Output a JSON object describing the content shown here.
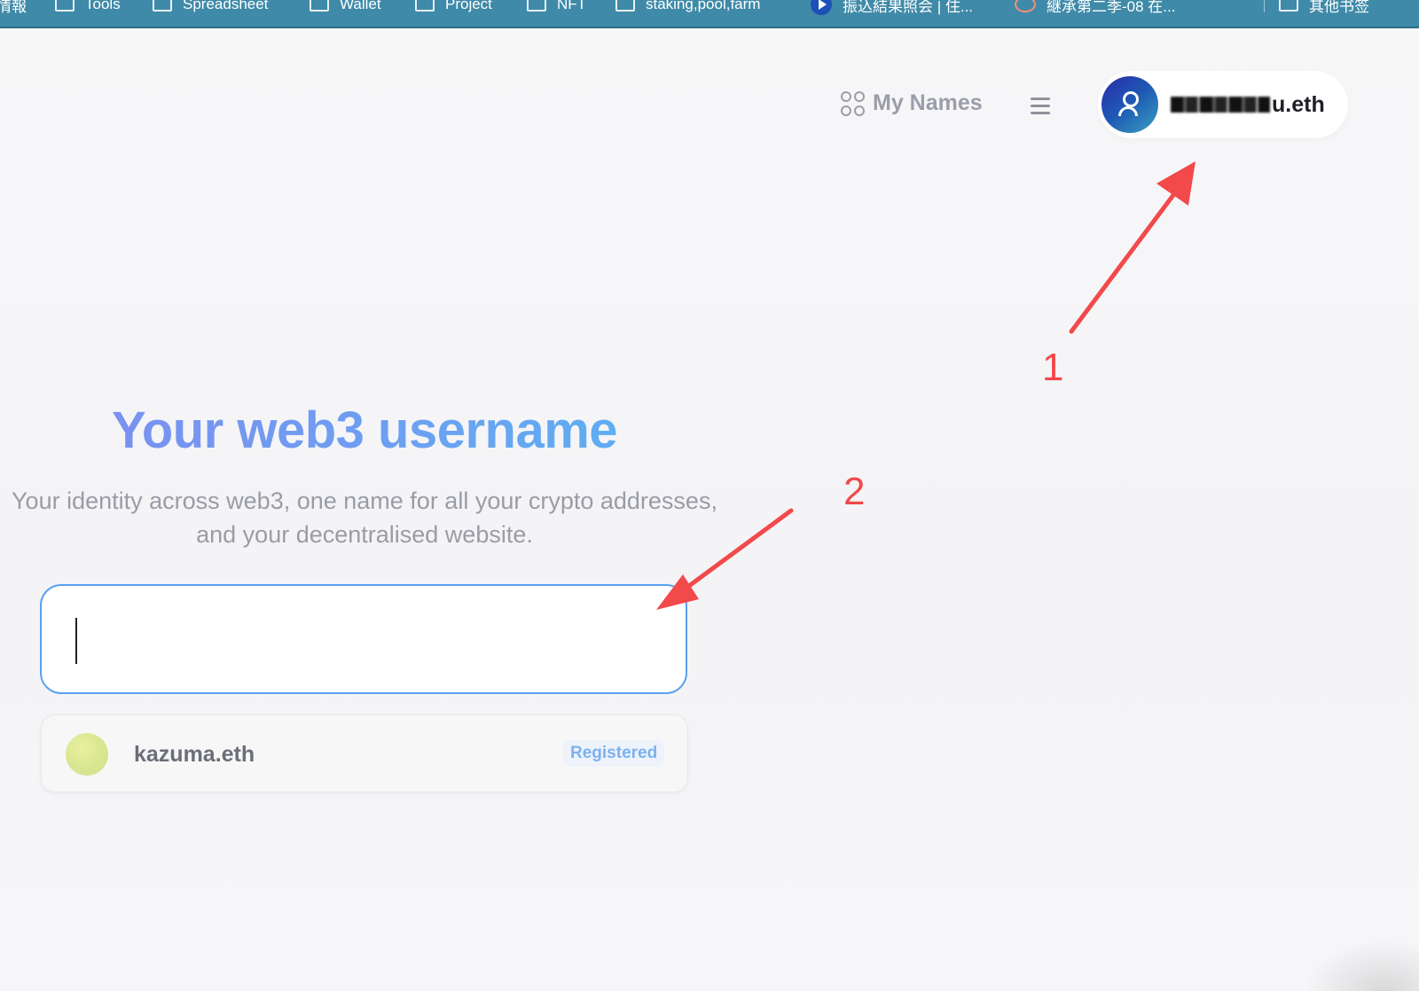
{
  "bookmarks_bar": {
    "items": [
      {
        "label": "情報",
        "icon": "none"
      },
      {
        "label": "Tools",
        "icon": "folder-icon"
      },
      {
        "label": "Spreadsheet",
        "icon": "folder-icon"
      },
      {
        "label": "Wallet",
        "icon": "folder-icon"
      },
      {
        "label": "Project",
        "icon": "folder-icon"
      },
      {
        "label": "NFT",
        "icon": "folder-icon"
      },
      {
        "label": "staking,pool,farm",
        "icon": "folder-icon"
      },
      {
        "label": "振込結果照会 | 住...",
        "icon": "play-circle-icon"
      },
      {
        "label": "継承第二季-08 在...",
        "icon": "swirl-icon"
      },
      {
        "label": "其他书签",
        "icon": "folder-icon"
      }
    ]
  },
  "header": {
    "my_names_label": "My Names",
    "profile_name_suffix": "u.eth"
  },
  "hero": {
    "title": "Your web3 username",
    "subtitle_line1": "Your identity across web3, one name for all your crypto addresses,",
    "subtitle_line2": "and your decentralised website."
  },
  "search": {
    "value": "",
    "placeholder": ""
  },
  "results": [
    {
      "name": "kazuma.eth",
      "status": "Registered"
    }
  ],
  "annotations": {
    "label_1": "1",
    "label_2": "2",
    "color": "#f2494b"
  },
  "colors": {
    "bookmarks_bar": "#3f8aa8",
    "title_gradient_start": "#7f8cef",
    "title_gradient_end": "#58b4f2",
    "search_border": "#5aa0f0",
    "badge_text": "#7bb1ef"
  }
}
